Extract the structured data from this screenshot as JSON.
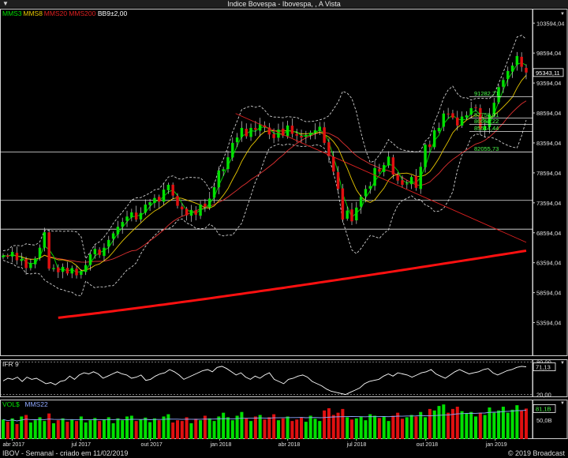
{
  "window": {
    "title": "Indice Bovespa - Ibovespa, , A Vista"
  },
  "legend_main": [
    {
      "label": "MMS3",
      "color": "#00e000"
    },
    {
      "label": "MMS8",
      "color": "#e8c800"
    },
    {
      "label": "MMS20",
      "color": "#e02020"
    },
    {
      "label": "MMS200",
      "color": "#e02020"
    },
    {
      "label": "BB9±2,00",
      "color": "#ffffff"
    }
  ],
  "legend_ifr": {
    "label": "IFR 9"
  },
  "legend_vol": [
    {
      "label": "VOL$",
      "color": "#00e000"
    },
    {
      "label": "MMS22",
      "color": "#8fa8ff"
    }
  ],
  "footer": {
    "left": "IBOV - Semanal - criado em 11/02/2019",
    "right": "© 2019 Broadcast"
  },
  "colors": {
    "up": "#00e000",
    "down": "#e01010",
    "ma3": "#00e000",
    "ma8": "#e8c800",
    "ma20": "#e03030",
    "ma200": "#ff1010",
    "bands": "#cfcfcf",
    "grid": "#ffffff"
  },
  "chart_data": [
    {
      "type": "candlestick",
      "title": "Indice Bovespa - Ibovespa, , A Vista",
      "frequency": "weekly",
      "xlim": [
        "2017-03-20",
        "2019-02-11"
      ],
      "x_tick_labels": [
        "abr 2017",
        "jul 2017",
        "out 2017",
        "jan 2018",
        "abr 2018",
        "jul 2018",
        "out 2018",
        "jan 2019"
      ],
      "ylim": [
        48000,
        106000
      ],
      "y_tick_labels": [
        "103594,04",
        "98594,04",
        "93594,04",
        "88594,04",
        "83594,04",
        "78594,04",
        "73594,04",
        "68594,04",
        "63594,04",
        "58594,04",
        "53594,04"
      ],
      "last_price_label": "95343,11",
      "fibonacci_labels": [
        "91282,71",
        "87758,01",
        "86668,22",
        "85514,44",
        "82055,73"
      ],
      "horizontal_lines": [
        82055.73,
        74000,
        69200
      ],
      "trendline": {
        "from": {
          "x": "2018-01-22",
          "y": 88500
        },
        "to": {
          "x": "2019-02-11",
          "y": 67000
        }
      },
      "close": [
        64800,
        64600,
        65400,
        64000,
        64200,
        62700,
        63500,
        64300,
        66100,
        68700,
        62600,
        62700,
        62000,
        62900,
        61800,
        62700,
        61500,
        62200,
        63200,
        65000,
        65900,
        64900,
        66100,
        67400,
        68500,
        69600,
        70400,
        71300,
        72000,
        70800,
        71900,
        73300,
        73700,
        74400,
        73800,
        75800,
        76600,
        74800,
        73100,
        72500,
        71500,
        72400,
        71600,
        73300,
        72900,
        74300,
        76200,
        79000,
        79200,
        81200,
        83600,
        84500,
        86100,
        84700,
        86100,
        85800,
        86700,
        86200,
        85000,
        84400,
        85800,
        84800,
        86500,
        85100,
        84800,
        84500,
        84900,
        85300,
        85700,
        86300,
        83600,
        81400,
        78800,
        75900,
        70800,
        72300,
        70500,
        72800,
        74600,
        75900,
        76400,
        79400,
        78800,
        79900,
        81300,
        78300,
        77300,
        76600,
        76800,
        77900,
        76100,
        79600,
        83300,
        82900,
        85700,
        86100,
        88500,
        88400,
        87800,
        86500,
        88000,
        88200,
        89400,
        89500,
        85900,
        86400,
        88300,
        90300,
        92900,
        94100,
        95600,
        96500,
        98100,
        96300,
        95343.11
      ],
      "series": [
        {
          "name": "MMS3"
        },
        {
          "name": "MMS8"
        },
        {
          "name": "MMS20"
        },
        {
          "name": "MMS200"
        },
        {
          "name": "BB9±2,00"
        }
      ]
    },
    {
      "type": "line",
      "title": "IFR 9",
      "ylim": [
        15,
        85
      ],
      "y_tick_labels": [
        "80,00",
        "20,00"
      ],
      "last_value_label": "71,13",
      "values": [
        45,
        50,
        48,
        52,
        44,
        52,
        48,
        50,
        45,
        40,
        42,
        38,
        44,
        46,
        54,
        48,
        56,
        60,
        58,
        62,
        58,
        50,
        54,
        58,
        62,
        58,
        56,
        50,
        52,
        56,
        46,
        48,
        54,
        58,
        60,
        66,
        62,
        56,
        48,
        52,
        56,
        60,
        64,
        66,
        62,
        70,
        72,
        68,
        62,
        56,
        60,
        52,
        48,
        54,
        50,
        56,
        60,
        48,
        44,
        40,
        48,
        50,
        54,
        56,
        52,
        44,
        40,
        36,
        30,
        26,
        24,
        22,
        20,
        24,
        28,
        32,
        40,
        44,
        46,
        48,
        54,
        58,
        54,
        60,
        58,
        56,
        52,
        56,
        60,
        62,
        66,
        58,
        54,
        50,
        56,
        62,
        66,
        62,
        58,
        60,
        62,
        66,
        68,
        60,
        56,
        60,
        64,
        66,
        70,
        72,
        71.13
      ]
    },
    {
      "type": "bar",
      "title": "VOL$",
      "unit": "B",
      "ylim": [
        0,
        105
      ],
      "y_tick_labels": [
        "50,0B"
      ],
      "last_value_label": "81,1B",
      "values": [
        52,
        46,
        55,
        40,
        60,
        64,
        44,
        50,
        58,
        48,
        68,
        42,
        50,
        55,
        46,
        52,
        48,
        60,
        44,
        50,
        56,
        48,
        52,
        58,
        42,
        55,
        50,
        60,
        62,
        48,
        52,
        57,
        45,
        55,
        50,
        60,
        66,
        44,
        50,
        48,
        58,
        42,
        54,
        50,
        62,
        55,
        48,
        60,
        70,
        58,
        50,
        62,
        72,
        56,
        48,
        60,
        64,
        52,
        58,
        66,
        50,
        55,
        60,
        48,
        52,
        58,
        46,
        62,
        54,
        48,
        76,
        82,
        64,
        70,
        80,
        58,
        52,
        55,
        60,
        50,
        66,
        62,
        56,
        60,
        48,
        62,
        70,
        54,
        58,
        64,
        60,
        72,
        58,
        80,
        76,
        88,
        92,
        70,
        80,
        86,
        74,
        68,
        72,
        60,
        70,
        64,
        84,
        70,
        76,
        86,
        70,
        78,
        90,
        76,
        81.1
      ],
      "ma22_name": "MMS22"
    }
  ]
}
